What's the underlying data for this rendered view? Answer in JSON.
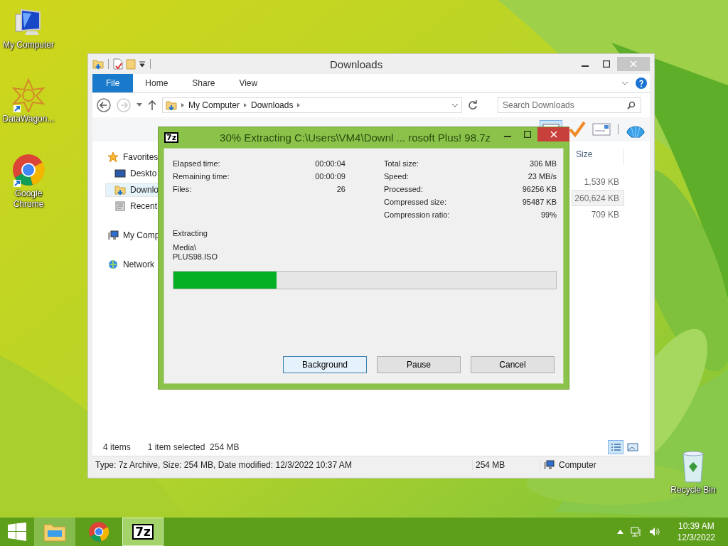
{
  "desktop_icons": [
    {
      "label": "My Computer",
      "kind": "computer"
    },
    {
      "label": "DataWagon...",
      "kind": "emblem"
    },
    {
      "label": "Google Chrome",
      "kind": "browser"
    },
    {
      "label": "Recycle Bin",
      "kind": "bin"
    }
  ],
  "explorer": {
    "title": "Downloads",
    "ribbon_tabs": [
      {
        "label": "File",
        "selected": true
      },
      {
        "label": "Home",
        "selected": false
      },
      {
        "label": "Share",
        "selected": false
      },
      {
        "label": "View",
        "selected": false
      }
    ],
    "breadcrumb": [
      "My Computer",
      "Downloads"
    ],
    "search": {
      "placeholder": "Search Downloads"
    },
    "nav": [
      {
        "label": "Favorites",
        "kind": "star",
        "selected": false,
        "children": [
          {
            "label": "Deskto",
            "kind": "desktop",
            "selected": false
          },
          {
            "label": "Downlo",
            "kind": "downloads",
            "selected": true
          },
          {
            "label": "Recent",
            "kind": "recent",
            "selected": false
          }
        ]
      },
      {
        "label": "My Comp",
        "kind": "computer",
        "selected": false
      },
      {
        "label": "Network",
        "kind": "network",
        "selected": false
      }
    ],
    "size_column": {
      "header": "Size",
      "rows": [
        {
          "size": "1,539 KB",
          "selected": false
        },
        {
          "size": "260,624 KB",
          "selected": true
        },
        {
          "size": "709 KB",
          "selected": false
        }
      ]
    },
    "item_count": "4 items",
    "selection_info": "1 item selected  254 MB",
    "status_bar": {
      "details": "Type: 7z Archive, Size: 254 MB, Date modified: 12/3/2022 10:37 AM",
      "size": "254 MB",
      "location": "Computer"
    }
  },
  "dialog": {
    "icon_text": "7z",
    "title": "30% Extracting C:\\Users\\VM4\\Downl ... rosoft Plus! 98.7z",
    "stats_left": [
      {
        "label": "Elapsed time:",
        "value": "00:00:04"
      },
      {
        "label": "Remaining time:",
        "value": "00:00:09"
      },
      {
        "label": "Files:",
        "value": "26"
      }
    ],
    "stats_right": [
      {
        "label": "Total size:",
        "value": "306 MB"
      },
      {
        "label": "Speed:",
        "value": "23 MB/s"
      },
      {
        "label": "Processed:",
        "value": "96256 KB"
      },
      {
        "label": "Compressed size:",
        "value": "95487 KB"
      },
      {
        "label": "Compression ratio:",
        "value": "99%"
      }
    ],
    "status": "Extracting",
    "path_lines": [
      "Media\\",
      "PLUS98.ISO"
    ],
    "progress": {
      "level": 0.27
    },
    "buttons": [
      {
        "label": "Background",
        "focused": true
      },
      {
        "label": "Pause",
        "focused": false
      },
      {
        "label": "Cancel",
        "focused": false
      }
    ]
  },
  "taskbar": {
    "apps": [
      {
        "kind": "explorer",
        "running": true,
        "selected": false
      },
      {
        "kind": "browser",
        "running": false,
        "selected": false
      },
      {
        "kind": "archiver",
        "label": "7z",
        "running": true,
        "selected": true
      }
    ],
    "clock": {
      "time": "10:39 AM",
      "date": "12/3/2022"
    }
  }
}
